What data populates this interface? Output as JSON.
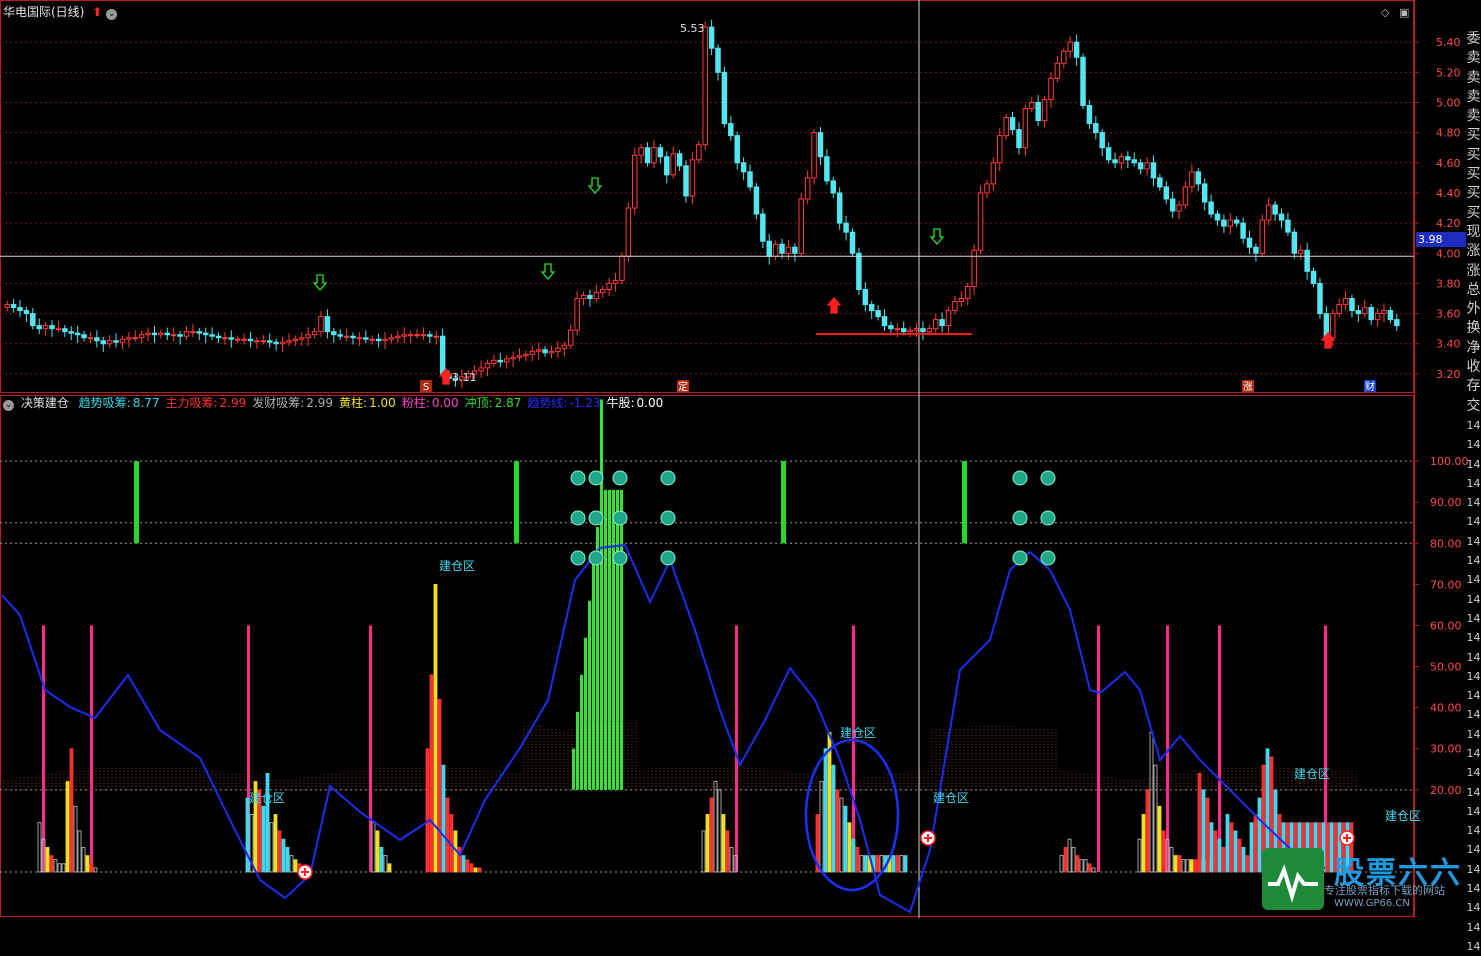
{
  "window": {
    "title": "华电国际(日线)",
    "price_tag": "3.98"
  },
  "indicator_header": {
    "name": "决策建仓",
    "items": [
      {
        "label": "趋势吸筹",
        "value": "8.77",
        "color": "#3ad8e8"
      },
      {
        "label": "主力吸筹",
        "value": "2.99",
        "color": "#ff3030"
      },
      {
        "label": "发财吸筹",
        "value": "2.99",
        "color": "#b0b0b0"
      },
      {
        "label": "黄柱",
        "value": "1.00",
        "color": "#f0e020"
      },
      {
        "label": "粉柱",
        "value": "0.00",
        "color": "#ff40c0"
      },
      {
        "label": "冲顶",
        "value": "2.87",
        "color": "#30e030"
      },
      {
        "label": "趋势线",
        "value": "-1.23",
        "color": "#2030ff"
      },
      {
        "label": "牛股",
        "value": "0.00",
        "color": "#ffffff"
      }
    ]
  },
  "side_labels": [
    "委",
    "卖",
    "卖",
    "卖",
    "卖",
    "买",
    "买",
    "买",
    "买",
    "买",
    "现",
    "涨",
    "涨",
    "总",
    "外",
    "换",
    "净",
    "收",
    "存",
    "交",
    "14",
    "14",
    "14",
    "14",
    "14",
    "14",
    "14",
    "14",
    "14",
    "14",
    "14",
    "14",
    "14",
    "14",
    "14",
    "14",
    "14",
    "14",
    "14",
    "14",
    "14",
    "14",
    "14",
    "14",
    "14",
    "14",
    "14",
    "14"
  ],
  "price_axis": [
    "5.40",
    "5.20",
    "5.00",
    "4.80",
    "4.60",
    "4.40",
    "4.20",
    "4.00",
    "3.80",
    "3.60",
    "3.40",
    "3.20"
  ],
  "indicator_axis": [
    "100.00",
    "90.00",
    "80.00",
    "70.00",
    "60.00",
    "50.00",
    "40.00",
    "30.00",
    "20.00"
  ],
  "annotations": {
    "high_label": "5.53",
    "low_label": "3.11",
    "zone_label": "建仓区",
    "badges": [
      "S",
      "定",
      "涨",
      "财"
    ]
  },
  "watermark": {
    "brand": "股票六六",
    "slogan": "专注股票指标下载的网站",
    "url": "WWW.GP66.CN"
  },
  "colors": {
    "up": "#ff3a3a",
    "down": "#52e6f0",
    "grid": "#7a1a1a",
    "axis": "#b02020",
    "trend": "#1a2ef0"
  },
  "chart_data": [
    {
      "type": "candlestick",
      "title": "华电国际(日线)",
      "ylim": [
        3.08,
        5.6
      ],
      "crosshair_price": 3.98,
      "close_series": [
        3.66,
        3.64,
        3.62,
        3.6,
        3.52,
        3.5,
        3.52,
        3.5,
        3.5,
        3.48,
        3.47,
        3.46,
        3.44,
        3.44,
        3.42,
        3.4,
        3.42,
        3.41,
        3.43,
        3.44,
        3.44,
        3.46,
        3.47,
        3.46,
        3.47,
        3.46,
        3.46,
        3.45,
        3.48,
        3.48,
        3.47,
        3.46,
        3.45,
        3.44,
        3.44,
        3.43,
        3.43,
        3.43,
        3.42,
        3.42,
        3.42,
        3.41,
        3.4,
        3.41,
        3.42,
        3.43,
        3.44,
        3.46,
        3.48,
        3.58,
        3.48,
        3.46,
        3.45,
        3.45,
        3.44,
        3.44,
        3.43,
        3.43,
        3.42,
        3.43,
        3.44,
        3.45,
        3.46,
        3.46,
        3.46,
        3.46,
        3.45,
        3.45,
        3.2,
        3.17,
        3.16,
        3.18,
        3.2,
        3.22,
        3.24,
        3.27,
        3.29,
        3.28,
        3.3,
        3.31,
        3.32,
        3.33,
        3.35,
        3.36,
        3.34,
        3.35,
        3.37,
        3.39,
        3.49,
        3.7,
        3.72,
        3.7,
        3.74,
        3.76,
        3.8,
        3.82,
        3.98,
        4.3,
        4.65,
        4.7,
        4.6,
        4.7,
        4.64,
        4.52,
        4.66,
        4.58,
        4.38,
        4.62,
        4.72,
        5.5,
        5.36,
        5.2,
        4.86,
        4.78,
        4.6,
        4.54,
        4.44,
        4.26,
        4.08,
        3.98,
        4.06,
        4.0,
        4.04,
        4.0,
        4.36,
        4.5,
        4.8,
        4.64,
        4.48,
        4.4,
        4.2,
        4.14,
        4.0,
        3.76,
        3.66,
        3.62,
        3.58,
        3.52,
        3.5,
        3.5,
        3.48,
        3.49,
        3.5,
        3.48,
        3.5,
        3.56,
        3.52,
        3.62,
        3.68,
        3.7,
        3.78,
        4.02,
        4.4,
        4.46,
        4.6,
        4.78,
        4.9,
        4.82,
        4.7,
        4.96,
        5.0,
        4.88,
        5.02,
        5.16,
        5.26,
        5.34,
        5.4,
        5.3,
        4.98,
        4.86,
        4.8,
        4.7,
        4.62,
        4.6,
        4.64,
        4.62,
        4.6,
        4.56,
        4.6,
        4.5,
        4.44,
        4.36,
        4.28,
        4.32,
        4.44,
        4.54,
        4.46,
        4.34,
        4.26,
        4.22,
        4.18,
        4.22,
        4.2,
        4.1,
        4.04,
        4.0,
        4.22,
        4.32,
        4.26,
        4.22,
        4.14,
        4.0,
        4.02,
        3.88,
        3.8,
        3.6,
        3.44,
        3.6,
        3.66,
        3.7,
        3.62,
        3.6,
        3.64,
        3.56,
        3.6,
        3.62,
        3.56,
        3.52
      ]
    },
    {
      "type": "bar",
      "title": "决策建仓",
      "ylim": [
        0,
        110
      ],
      "series": [
        {
          "name": "趋势吸筹",
          "value": 8.77
        },
        {
          "name": "主力吸筹",
          "value": 2.99
        },
        {
          "name": "发财吸筹",
          "value": 2.99
        },
        {
          "name": "黄柱",
          "value": 1.0
        },
        {
          "name": "粉柱",
          "value": 0.0
        },
        {
          "name": "冲顶",
          "value": 2.87
        },
        {
          "name": "趋势线",
          "value": -1.23
        },
        {
          "name": "牛股",
          "value": 0.0
        }
      ]
    }
  ]
}
